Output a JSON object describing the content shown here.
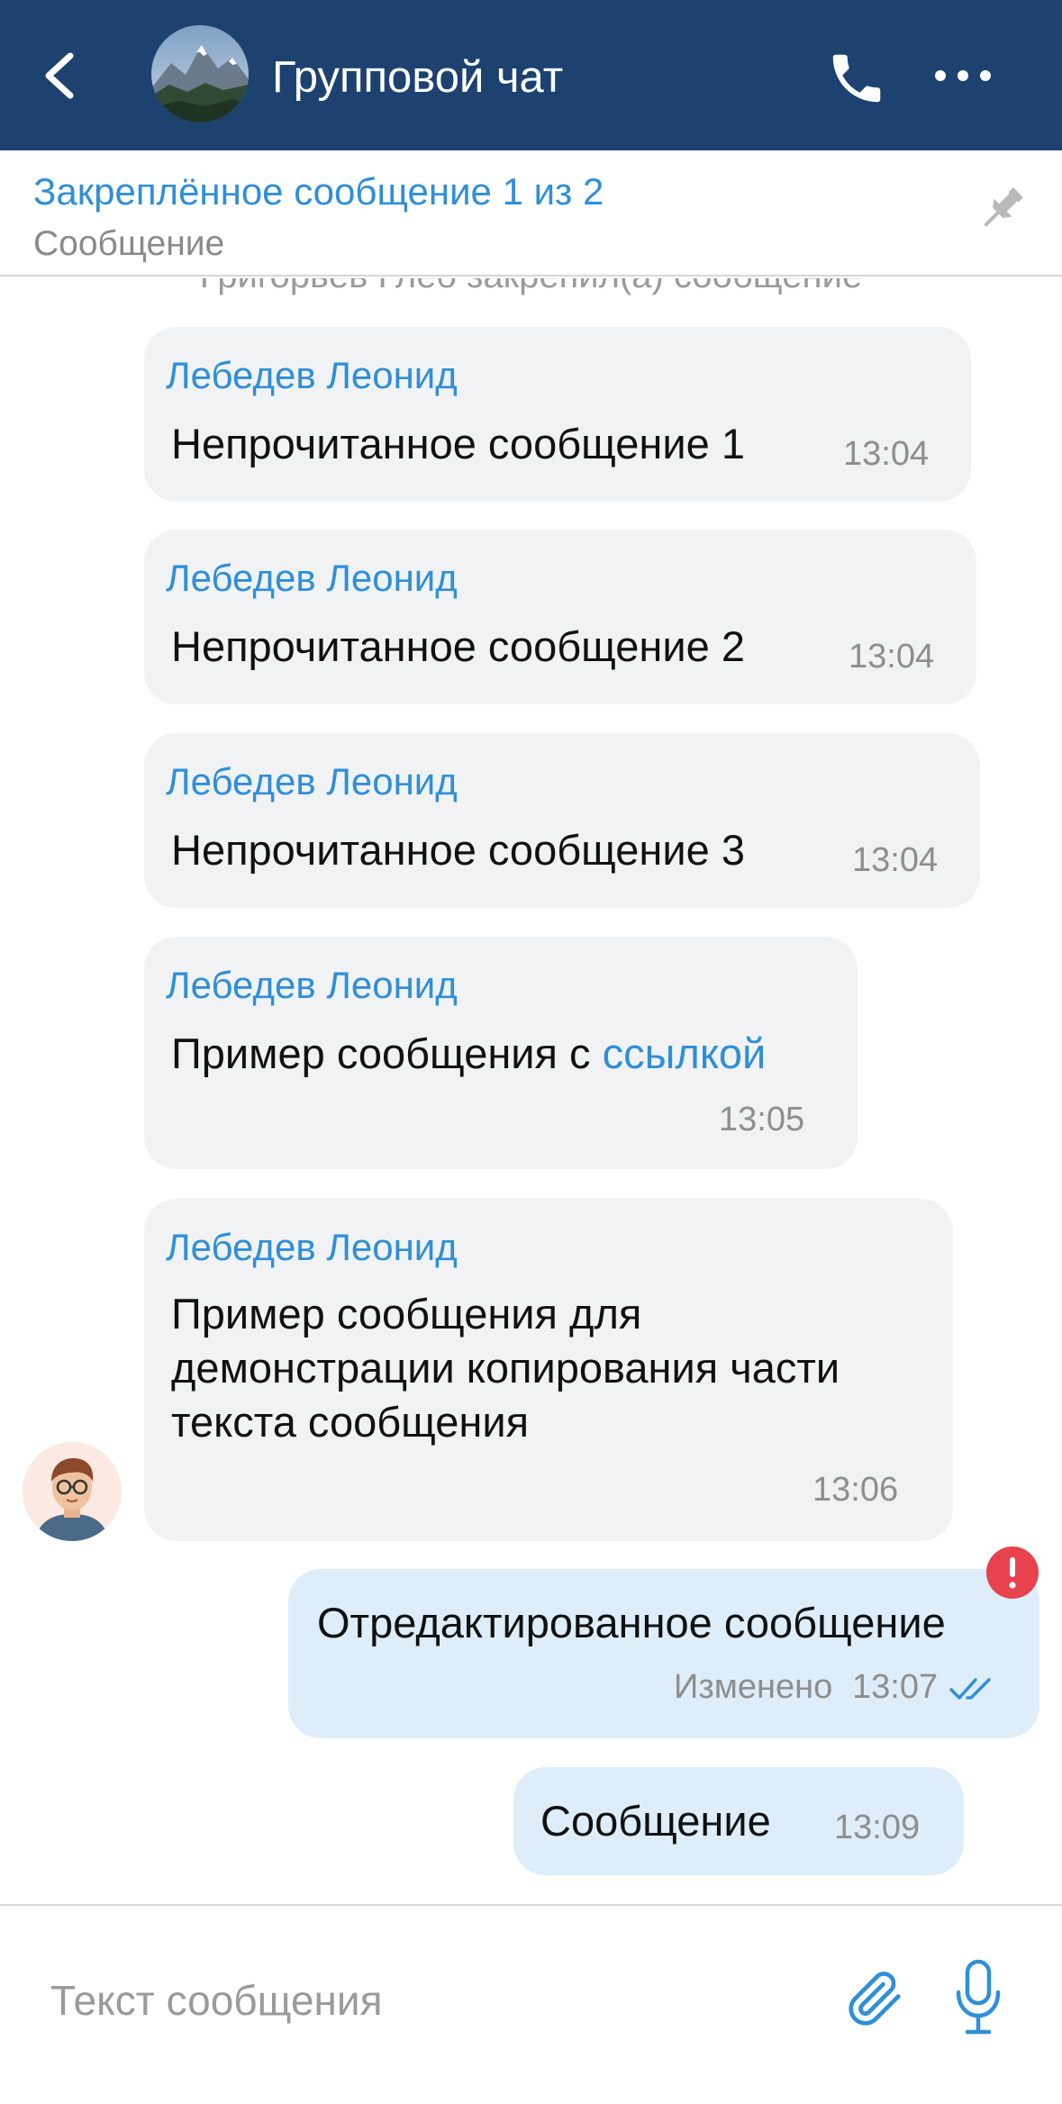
{
  "header": {
    "title": "Групповой чат",
    "back_icon": "chevron-left-icon",
    "call_icon": "phone-icon",
    "more_icon": "more-horizontal-icon",
    "bg_color": "#1d4270"
  },
  "pinned": {
    "title": "Закреплённое сообщение 1 из 2",
    "subtitle": "Сообщение",
    "icon": "pin-icon"
  },
  "system_message": "Григорьев Глеб закрепил(а) сообщение",
  "messages": [
    {
      "direction": "incoming",
      "sender": "Лебедев Леонид",
      "text": "Непрочитанное сообщение 1",
      "time": "13:04"
    },
    {
      "direction": "incoming",
      "sender": "Лебедев Леонид",
      "text": "Непрочитанное сообщение 2",
      "time": "13:04"
    },
    {
      "direction": "incoming",
      "sender": "Лебедев Леонид",
      "text": "Непрочитанное сообщение 3",
      "time": "13:04"
    },
    {
      "direction": "incoming",
      "sender": "Лебедев Леонид",
      "text_prefix": "Пример сообщения с ",
      "link_text": "ссылкой",
      "time": "13:05"
    },
    {
      "direction": "incoming",
      "sender": "Лебедев Леонид",
      "lines": [
        "Пример сообщения для",
        "демонстрации копирования части",
        "текста сообщения"
      ],
      "time": "13:06"
    },
    {
      "direction": "outgoing",
      "text": "Отредактированное сообщение",
      "edited_label": "Изменено",
      "time": "13:07",
      "status": "read"
    },
    {
      "direction": "outgoing",
      "text": "Сообщение",
      "time": "13:09",
      "status": "error"
    }
  ],
  "input": {
    "placeholder": "Текст сообщения",
    "value": "",
    "attach_icon": "paperclip-icon",
    "mic_icon": "microphone-icon"
  },
  "colors": {
    "accent": "#2f8fd8",
    "incoming_bubble": "#f1f2f4",
    "outgoing_bubble": "#ddeefa",
    "error": "#e8424f"
  }
}
